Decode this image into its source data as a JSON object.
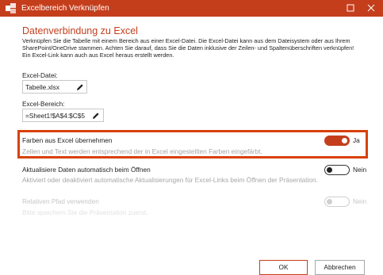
{
  "window": {
    "title": "Excelbereich Verknüpfen",
    "accent_color": "#c43e1c",
    "icons": [
      "app-icon",
      "maximize-icon",
      "close-icon"
    ]
  },
  "heading": "Datenverbindung zu Excel",
  "description": [
    "Verknüpfen Sie die Tabelle mit einem Bereich aus einer Excel-Datei. Die Excel-Datei kann aus dem Dateisystem oder aus Ihrem",
    "SharePoint/OneDrive stammen. Achten Sie darauf, dass Sie die Daten inklusive der Zeilen- und Spaltenüberschriften verknüpfen!",
    "Ein Excel-Link kann auch aus Excel heraus erstellt werden."
  ],
  "excel_file": {
    "label": "Excel-Datei:",
    "value": "Tabelle.xlsx",
    "icon": "pencil-icon"
  },
  "excel_range": {
    "label": "Excel-Bereich:",
    "value": "=Sheet1!$A$4:$C$5",
    "icon": "pencil-icon"
  },
  "options": [
    {
      "title": "Farben aus Excel übernehmen",
      "description": "Zellen und Text werden entsprechend der in Excel eingestellten Farben eingefärbt.",
      "toggle_label": "Ja",
      "state": "on",
      "highlighted": true
    },
    {
      "title": "Aktualisiere Daten automatisch beim Öffnen",
      "description": "Aktiviert oder deaktiviert automatische Aktualisierungen für Excel-Links beim Öffnen der Präsentation.",
      "toggle_label": "Nein",
      "state": "off",
      "highlighted": false
    },
    {
      "title": "Relativen Pfad verwenden",
      "description": "Bitte speichern Sie die Präsentation zuerst.",
      "toggle_label": "Nein",
      "state": "disabled",
      "highlighted": false
    }
  ],
  "buttons": {
    "ok": "OK",
    "cancel": "Abbrechen"
  }
}
